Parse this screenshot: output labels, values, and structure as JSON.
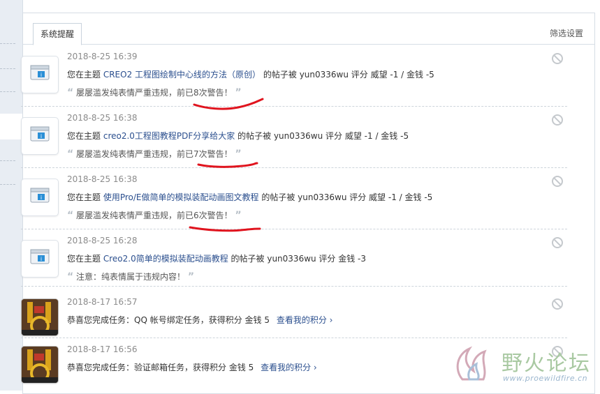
{
  "header": {
    "tab_label": "系统提醒",
    "filter_label": "筛选设置"
  },
  "notices": [
    {
      "time": "2018-8-25 16:39",
      "prefix": "您在主题",
      "topic": "CREO2 工程图绘制中心线的方法（原创）",
      "suffix": "的帖子被 yun0336wu 评分 威望 -1 / 金钱 -5",
      "quote": "屡屡滥发纯表情严重违规，前已8次警告！"
    },
    {
      "time": "2018-8-25 16:38",
      "prefix": "您在主题",
      "topic": "creo2.0工程图教程PDF分享给大家",
      "suffix": "的帖子被 yun0336wu 评分 威望 -1 / 金钱 -5",
      "quote": "屡屡滥发纯表情严重违规，前已7次警告！"
    },
    {
      "time": "2018-8-25 16:38",
      "prefix": "您在主题",
      "topic": "使用Pro/E做简单的模拟装配动画图文教程",
      "suffix": "的帖子被 yun0336wu 评分 威望 -1 / 金钱 -5",
      "quote": "屡屡滥发纯表情严重违规，前已6次警告！"
    },
    {
      "time": "2018-8-25 16:28",
      "prefix": "您在主题",
      "topic": "Creo2.0简单的模拟装配动画教程",
      "suffix": "的帖子被 yun0336wu 评分 金钱 -3",
      "quote": "注意：纯表情属于违规内容！"
    },
    {
      "time": "2018-8-17 16:57",
      "text": "恭喜您完成任务：QQ 帐号绑定任务，获得积分 金钱 5",
      "link": "查看我的积分 ›"
    },
    {
      "time": "2018-8-17 16:56",
      "text": "恭喜您完成任务：验证邮箱任务，获得积分 金钱 5",
      "link": "查看我的积分 ›"
    }
  ],
  "quote_marks": {
    "open": "“",
    "close": "”"
  },
  "watermark": {
    "name": "野火论坛",
    "url": "www.proewildfire.cn"
  },
  "colors": {
    "link": "#2b4f8e",
    "annotation": "#e0141e",
    "meta": "#8b8b8b"
  },
  "icons": {
    "system": "system-notice-icon",
    "dismiss": "dismiss-icon"
  }
}
